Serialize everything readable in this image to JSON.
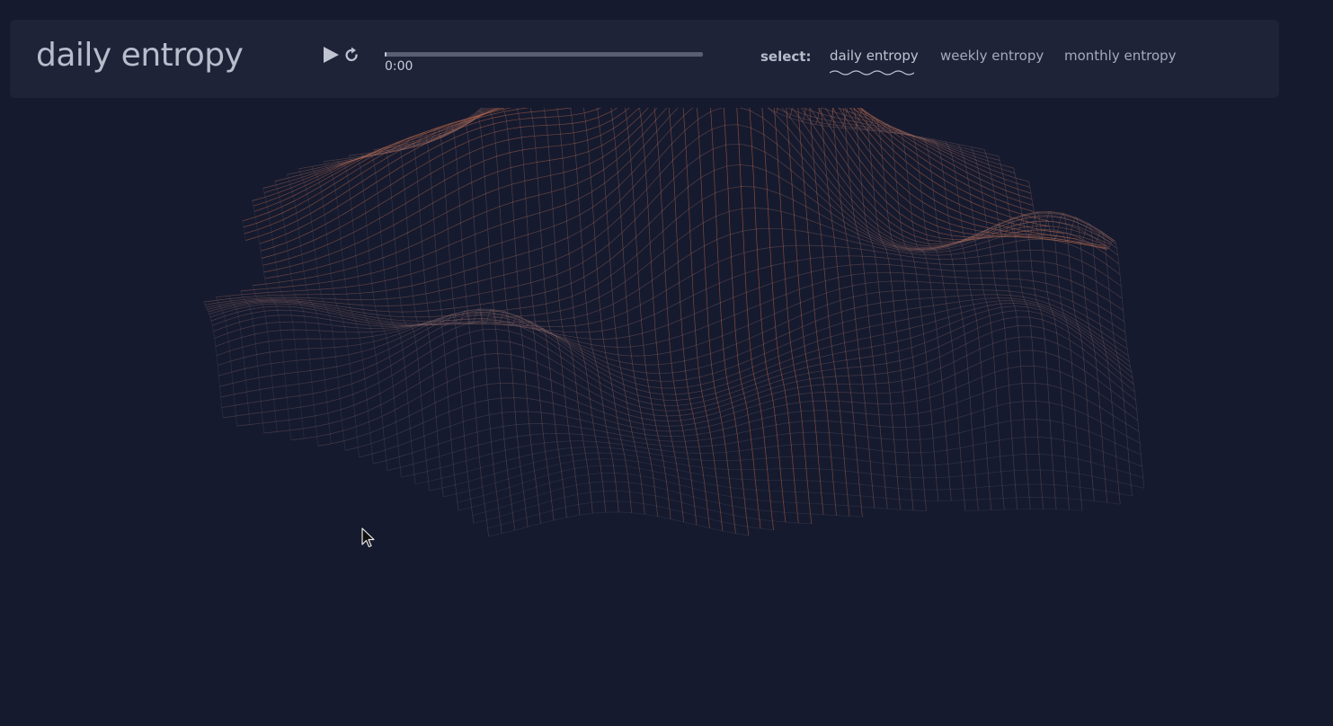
{
  "header": {
    "title": "daily entropy"
  },
  "player": {
    "play_icon": "play-icon",
    "reset_icon": "reset-icon",
    "progress": 0.0,
    "time": "0:00"
  },
  "selector": {
    "label": "select:",
    "options": [
      "daily entropy",
      "weekly entropy",
      "monthly entropy"
    ],
    "selected": "daily entropy"
  },
  "visualization": {
    "type": "3D wireframe terrain",
    "peak_color": "#e8621f",
    "low_color": "#6a6f8c",
    "background": "#161a2e"
  },
  "colors": {
    "page_background": "#161a2e",
    "toolbar_background": "#1f2338",
    "text": "#b9bccb"
  }
}
